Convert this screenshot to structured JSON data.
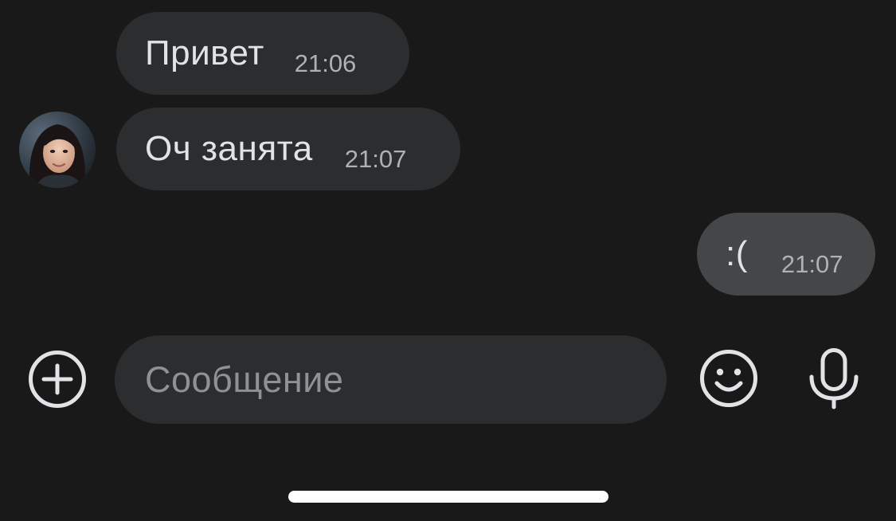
{
  "messages": [
    {
      "direction": "incoming",
      "text": "Привет",
      "time": "21:06"
    },
    {
      "direction": "incoming",
      "text": "Оч занята",
      "time": "21:07"
    },
    {
      "direction": "outgoing",
      "text": ":(",
      "time": "21:07"
    }
  ],
  "composer": {
    "placeholder": "Сообщение",
    "left_icon": "plus-circle-icon",
    "right_icons": [
      "emoji-smile-icon",
      "microphone-icon"
    ]
  },
  "colors": {
    "background": "#19191a",
    "incoming_bubble": "#2c2d2e",
    "outgoing_bubble": "#454647",
    "text": "#e1e3e6",
    "time": "#aeb1b5",
    "placeholder": "#8e9196",
    "icon": "#e1e3e6"
  }
}
